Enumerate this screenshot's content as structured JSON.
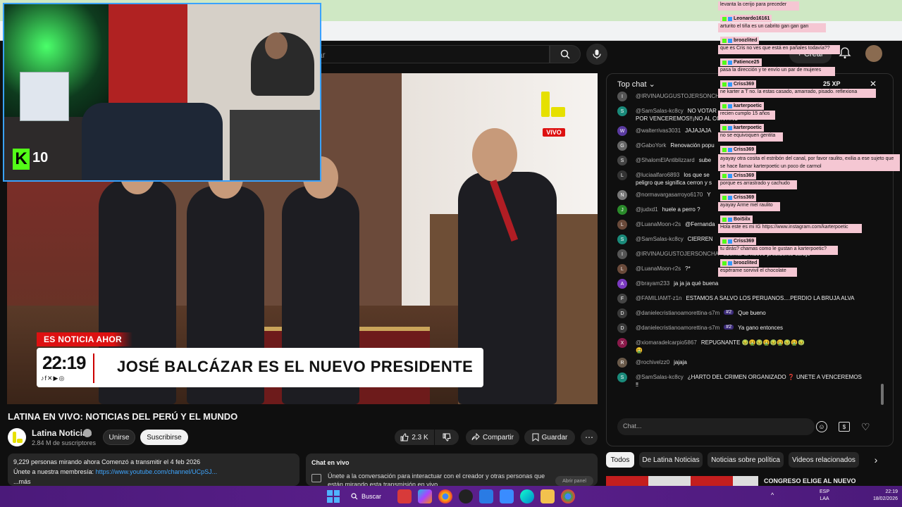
{
  "youtube": {
    "search_placeholder": "ar",
    "create_label": "+ Crear"
  },
  "video": {
    "vivo_badge": "VIVO",
    "breaking_label": "ES NOTICIA AHOR",
    "lower_third_time": "22:19",
    "lower_third_social": "♪f✕▶◎",
    "headline": "JOSÉ BALCÁZAR ES EL NUEVO PRESIDENTE",
    "title": "LATINA EN VIVO: NOTICIAS DEL PERÚ Y EL MUNDO"
  },
  "channel": {
    "name": "Latina Noticias",
    "subscribers": "2.84 M de suscriptores",
    "join_label": "Unirse",
    "subscribe_label": "Suscribirse"
  },
  "actions": {
    "likes": "2.3 K",
    "share_label": "Compartir",
    "save_label": "Guardar"
  },
  "description": {
    "line1": "9,229 personas mirando ahora  Comenzó a transmitir el 4 feb 2026",
    "line2_prefix": "Únete a nuestra membresía: ",
    "line2_link": "https://www.youtube.com/channel/UCpSJ...",
    "more": "...más"
  },
  "live_chat_box": {
    "title": "Chat en vivo",
    "text": "Únete a la conversación para interactuar con el creador y otras personas que están mirando esta transmisión en vivo.",
    "open_panel": "Abrir panel"
  },
  "overlay": {
    "kick_count": "10",
    "kick_letter": "K"
  },
  "chat": {
    "header": "Top chat",
    "xp": "25 XP",
    "input_placeholder": "Chat...",
    "messages": [
      {
        "user": "@IRVINAUGGUSTOJERSONCHA",
        "msg": "",
        "color": "#555",
        "initial": "I"
      },
      {
        "user": "@SamSalas-kc8cy",
        "msg": "NO VOTAR",
        "color": "#1a8a7a",
        "initial": "S"
      },
      {
        "user": "",
        "msg": "POR VENCEREMOS!!¡NO AL CONTINU",
        "color": "",
        "initial": ""
      },
      {
        "user": "@walterrivas3031",
        "msg": "JAJAJAJA",
        "color": "#5a3aa0",
        "initial": "W"
      },
      {
        "user": "@GaboYork",
        "msg": "Renovación popu",
        "color": "#666",
        "initial": "G"
      },
      {
        "user": "@ShalomElAntiblizzard",
        "msg": "sube",
        "color": "#444",
        "initial": "S"
      },
      {
        "user": "@luciaalfaro6893",
        "msg": "los que se",
        "color": "#333",
        "initial": "L"
      },
      {
        "user": "",
        "msg": "peligro que significa cerron y s",
        "color": "",
        "initial": ""
      },
      {
        "user": "@normavargasarroyo6170",
        "msg": "Y",
        "color": "#777",
        "initial": "N"
      },
      {
        "user": "@judxd1",
        "msg": "huele a perro ?",
        "color": "#2a8a2a",
        "initial": "J"
      },
      {
        "user": "@LuanaMoon-r2s",
        "msg": "@Fernanda",
        "color": "#6a4a3a",
        "initial": "L"
      },
      {
        "user": "@SamSalas-kc8cy",
        "msg": "CIERREN",
        "color": "#1a8a7a",
        "initial": "S"
      },
      {
        "user": "@IRVINAUGUSTOJERSONCHA",
        "msg": "obernar al nuevo presidente carajo",
        "color": "#555",
        "initial": "I"
      },
      {
        "user": "@LuanaMoon-r2s",
        "msg": "?*",
        "color": "#6a4a3a",
        "initial": "L"
      },
      {
        "user": "@brayam233",
        "msg": "ja ja ja qué buena",
        "color": "#7a3ac0",
        "initial": "A"
      },
      {
        "user": "@FAMILIAMT-z1n",
        "msg": "ESTAMOS A SALVO LOS PERUANOS....PERDIO LA BRUJA ALVA",
        "color": "#444",
        "initial": "F"
      },
      {
        "user": "@danielecristianoamorettina-s7m",
        "badge": "#2",
        "msg": "Que bueno",
        "color": "#3a3a3a",
        "initial": "D"
      },
      {
        "user": "@danielecristianoamorettina-s7m",
        "badge": "#2",
        "msg": "Ya gano entonces",
        "color": "#3a3a3a",
        "initial": "D"
      },
      {
        "user": "@xiomaradelcarpio5867",
        "msg": "REPUGNANTE 🤢🤮🤢🤮🤢🤮🤢🤮🤢",
        "color": "#8a1a4a",
        "initial": "X"
      },
      {
        "user": "",
        "msg": "🤮",
        "color": "",
        "initial": ""
      },
      {
        "user": "@rochivelzz0",
        "msg": "jajaja",
        "color": "#6a5a4a",
        "initial": "R"
      },
      {
        "user": "@SamSalas-kc8cy",
        "msg": "¿HARTO DEL CRIMEN ORGANIZADO ❓ UNETE A VENCEREMOS",
        "color": "#1a8a7a",
        "initial": "S"
      },
      {
        "user": "",
        "msg": "‼",
        "color": "",
        "initial": ""
      }
    ]
  },
  "chips": {
    "all": "Todos",
    "latina": "De Latina Noticias",
    "politica": "Noticias sobre política",
    "related": "Videos relacionados"
  },
  "related": {
    "title": "CONGRESO ELIGE AL NUEVO"
  },
  "kick_chat": [
    {
      "type": "line",
      "text": "levanta la cerijo para preceder"
    },
    {
      "type": "user",
      "text": "Leonardo16161"
    },
    {
      "type": "line",
      "text": "arturito el tiña es un cabrito gan gan gan"
    },
    {
      "type": "user",
      "text": "broozlited"
    },
    {
      "type": "line",
      "text": "que es Cris no ves que está en pañales todavía??"
    },
    {
      "type": "user",
      "text": "Patience25"
    },
    {
      "type": "line",
      "text": "pasa la dirección y te envío un par de mujeres"
    },
    {
      "type": "user",
      "text": "Criss369"
    },
    {
      "type": "line",
      "text": "ne karter a T no. la estas casado, amarrado, pisado. reflexiona"
    },
    {
      "type": "user",
      "text": "karterpoetic"
    },
    {
      "type": "line",
      "text": "recien cumplo 15 años"
    },
    {
      "type": "user",
      "text": "karterpoetic"
    },
    {
      "type": "line",
      "text": "no se equivoquen gentita"
    },
    {
      "type": "user",
      "text": "Criss369"
    },
    {
      "type": "line",
      "text": "ayayay otra cosita el estribón del canal, por favor raulito, exilia a ese sujeto que se hace llamar karterpoetic un poco de carmol"
    },
    {
      "type": "user",
      "text": "Criss369"
    },
    {
      "type": "line",
      "text": "porque es arrastrado y cachudo"
    },
    {
      "type": "user",
      "text": "Criss369"
    },
    {
      "type": "line",
      "text": "ayayay Arme mel raulito"
    },
    {
      "type": "user",
      "text": "BoiSilx"
    },
    {
      "type": "line",
      "text": "Hola este es mi IG https://www.instagram.com/karterpoetic"
    },
    {
      "type": "user",
      "text": "Criss369"
    },
    {
      "type": "line",
      "text": "tu dirás? chamas como le gustan a karterpoetic?"
    },
    {
      "type": "user",
      "text": "broozlited"
    },
    {
      "type": "line",
      "text": "espérame sorvivil el chocolate"
    }
  ],
  "taskbar": {
    "search_label": "Buscar",
    "lang_line1": "ESP",
    "lang_line2": "LAA",
    "time": "22:19",
    "date": "18/02/2026"
  },
  "colors": {
    "youtube_bg": "#0f0f0f",
    "accent_red": "#cc0000",
    "kick_green": "#53fc18",
    "kick_chat_bg": "#f5c7d3",
    "taskbar": "#5b1f8c",
    "link": "#3ea6ff"
  }
}
